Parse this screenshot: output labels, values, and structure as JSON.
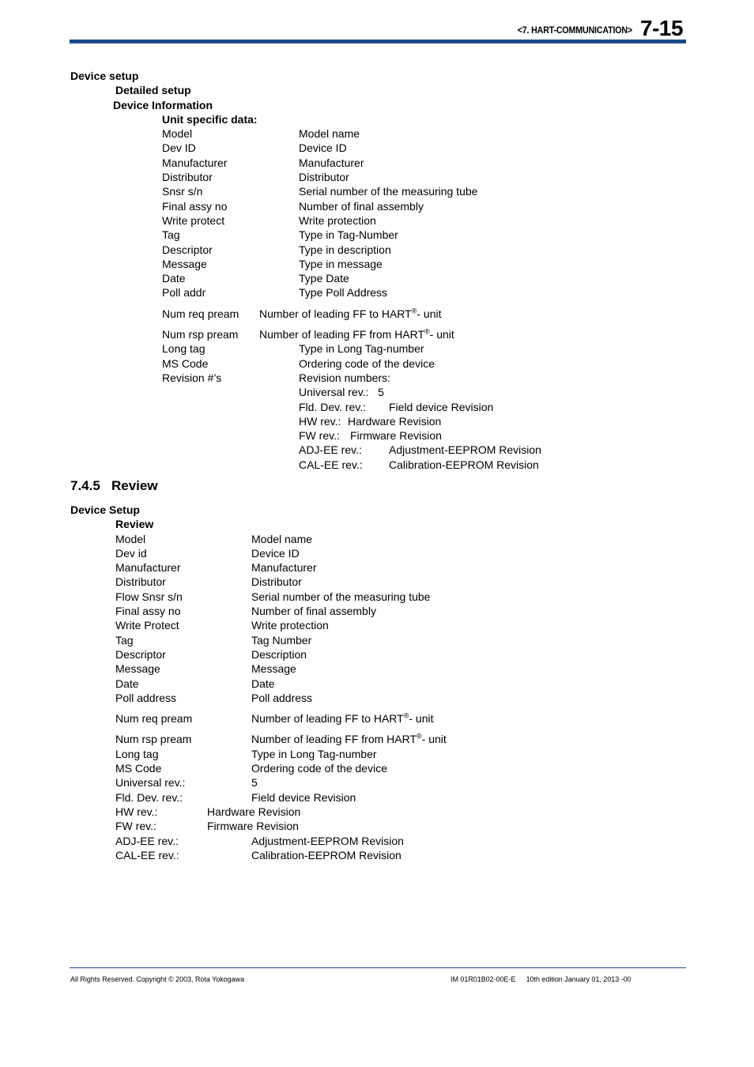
{
  "header": {
    "chapter": "<7. HART-COMMUNICATION>",
    "page_number": "7-15",
    "rule_color": "#1a4a8a"
  },
  "section_device_setup": {
    "title": "Device setup",
    "sub_title": "Detailed setup",
    "sub_sub_title": "Device Information",
    "group_title": "Unit specific data:",
    "rows": [
      {
        "label": "Model",
        "desc": "Model name"
      },
      {
        "label": "Dev ID",
        "desc": "Device ID"
      },
      {
        "label": "Manufacturer",
        "desc": "Manufacturer"
      },
      {
        "label": "Distributor",
        "desc": "Distributor"
      },
      {
        "label": "Snsr s/n",
        "desc": "Serial number of the measuring tube"
      },
      {
        "label": "Final assy no",
        "desc": "Number of final assembly"
      },
      {
        "label": "Write protect",
        "desc": "Write protection"
      },
      {
        "label": "Tag",
        "desc": "Type in Tag-Number"
      },
      {
        "label": "Descriptor",
        "desc": "Type in description"
      },
      {
        "label": "Message",
        "desc": "Type in message"
      },
      {
        "label": "Date",
        "desc": "Type Date"
      },
      {
        "label": "Poll addr",
        "desc": "Type Poll Address"
      }
    ],
    "pream_req": {
      "label": "Num req pream",
      "desc_before": "Number of leading FF to HART",
      "reg": "®",
      "desc_after": "- unit"
    },
    "pream_rsp": {
      "label": "Num rsp pream",
      "desc_before": "Number of leading FF from HART",
      "reg": "®",
      "desc_after": "- unit"
    },
    "rows_tail": [
      {
        "label": "Long tag",
        "desc": "Type in Long Tag-number"
      },
      {
        "label": "MS Code",
        "desc": "Ordering code of the device"
      },
      {
        "label": "Revision #’s",
        "desc": "Revision numbers:"
      }
    ],
    "revisions": [
      {
        "label": "Universal rev.:",
        "value": "5"
      },
      {
        "label": "Fld. Dev. rev.:",
        "value": "Field device Revision"
      },
      {
        "label": "HW rev.:",
        "value": "Hardware Revision"
      },
      {
        "label": "FW rev.:",
        "value": "Firmware Revision"
      },
      {
        "label": "ADJ-EE rev.:",
        "value": "Adjustment-EEPROM Revision"
      },
      {
        "label": "CAL-EE rev.:",
        "value": "Calibration-EEPROM Revision"
      }
    ]
  },
  "section_review": {
    "number": "7.4.5",
    "title": "Review",
    "device_setup_title": "Device Setup",
    "review_title": "Review",
    "rows": [
      {
        "label": "Model",
        "desc": "Model name"
      },
      {
        "label": "Dev id",
        "desc": "Device ID"
      },
      {
        "label": "Manufacturer",
        "desc": "Manufacturer"
      },
      {
        "label": "Distributor",
        "desc": "Distributor"
      },
      {
        "label": "Flow Snsr s/n",
        "desc": "Serial number of the measuring tube"
      },
      {
        "label": "Final assy no",
        "desc": "Number of final assembly"
      },
      {
        "label": "Write Protect",
        "desc": "Write protection"
      },
      {
        "label": "Tag",
        "desc": "Tag Number"
      },
      {
        "label": "Descriptor",
        "desc": "Description"
      },
      {
        "label": "Message",
        "desc": "Message"
      },
      {
        "label": "Date",
        "desc": "Date"
      },
      {
        "label": "Poll address",
        "desc": "Poll address"
      }
    ],
    "pream_req": {
      "label": "Num req pream",
      "desc_before": "Number of leading FF to HART",
      "reg": "®",
      "desc_after": "- unit"
    },
    "pream_rsp": {
      "label": "Num rsp pream",
      "desc_before": "Number of leading FF from HART",
      "reg": "®",
      "desc_after": "- unit"
    },
    "rows_tail": [
      {
        "label": "Long tag",
        "desc": "Type in Long Tag-number"
      },
      {
        "label": "MS Code",
        "desc": "Ordering code of the device"
      },
      {
        "label": "Universal rev.:",
        "desc": "5"
      },
      {
        "label": "Fld. Dev. rev.:",
        "desc": "Field device Revision"
      },
      {
        "label": "HW rev.:",
        "desc": "Hardware Revision"
      },
      {
        "label": "FW rev.:",
        "desc": "Firmware Revision"
      },
      {
        "label": "ADJ-EE rev.:",
        "desc": "Adjustment-EEPROM Revision"
      },
      {
        "label": "CAL-EE rev.:",
        "desc": "Calibration-EEPROM Revision"
      }
    ]
  },
  "footer": {
    "copyright": "All Rights Reserved. Copyright © 2003, Rota Yokogawa",
    "doc_id": "IM 01R01B02-00E-E",
    "edition": "10th edition January 01, 2013 -00"
  }
}
